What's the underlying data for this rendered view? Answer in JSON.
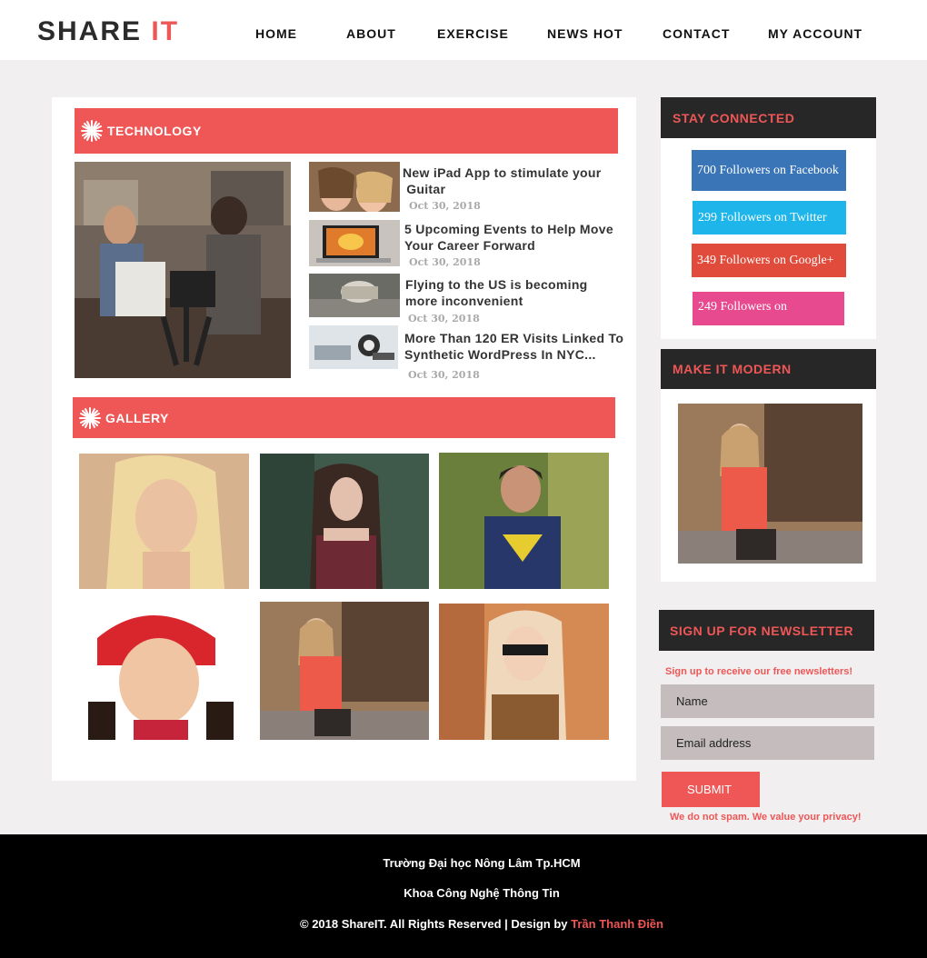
{
  "header": {
    "logo_main": "SHARE",
    "logo_accent": "IT",
    "nav": [
      "HOME",
      "ABOUT",
      "EXERCISE",
      "NEWS HOT",
      "CONTACT",
      "MY ACCOUNT"
    ]
  },
  "technology": {
    "title": "TECHNOLOGY",
    "articles": [
      {
        "title_line1": "New iPad App to stimulate your",
        "title_line2": " Guitar",
        "date": "Oct 30, 2018"
      },
      {
        "title_line1": "5 Upcoming Events to Help Move",
        "title_line2": "Your Career Forward",
        "date": "Oct 30, 2018"
      },
      {
        "title_line1": "Flying to the US is becoming",
        "title_line2": "more inconvenient",
        "date": "Oct 30, 2018"
      },
      {
        "title_line1": "More Than 120 ER Visits Linked To",
        "title_line2": "Synthetic WordPress In NYC...",
        "date": "Oct 30, 2018"
      }
    ]
  },
  "gallery": {
    "title": "GALLERY"
  },
  "sidebar": {
    "stay_connected": "STAY CONNECTED",
    "followers": [
      {
        "label": "700 Followers on Facebook",
        "color": "#3a75b8"
      },
      {
        "label": "299 Followers on Twitter",
        "color": "#1eb6ea"
      },
      {
        "label": "349 Followers on Google+",
        "color": "#e14b3b"
      },
      {
        "label": "249 Followers on",
        "color": "#e74a8f"
      }
    ],
    "make_modern": "MAKE IT MODERN",
    "newsletter": {
      "title": "SIGN UP FOR NEWSLETTER",
      "subtitle": "Sign up to receive our free newsletters!",
      "name_placeholder": "Name",
      "email_placeholder": "Email address",
      "submit": "SUBMIT",
      "note": "We do not spam. We value your privacy!"
    }
  },
  "footer": {
    "line1": "Trường Đại học Nông Lâm Tp.HCM",
    "line2": "Khoa Công Nghệ Thông Tin",
    "line3": "© 2018 ShareIT. All Rights Reserved | Design by ",
    "author": "Trần Thanh Điền"
  },
  "colors": {
    "accent": "#ef5656",
    "dark": "#272727"
  }
}
